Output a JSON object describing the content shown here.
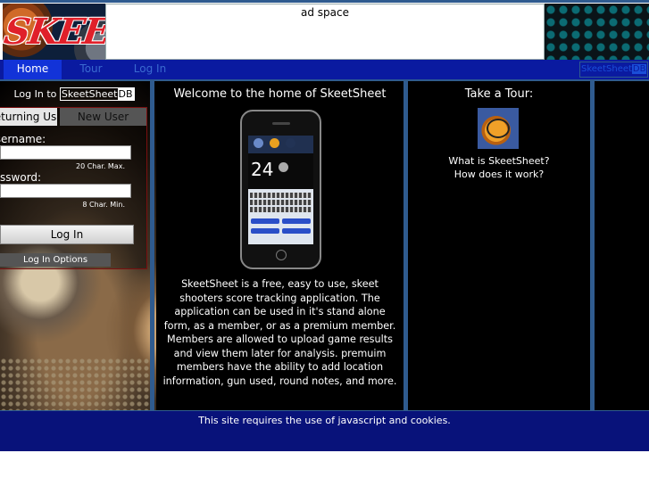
{
  "header": {
    "logo_text": "SKEETS",
    "ad_text": "ad space"
  },
  "nav": {
    "home": "Home",
    "tour": "Tour",
    "login": "Log In",
    "sheetdb_a": "SkeetSheet",
    "sheetdb_b": "DB"
  },
  "login": {
    "title_prefix": "Log In to",
    "badge_a": "SkeetSheet",
    "badge_b": "DB",
    "tab_returning": "Returning User",
    "tab_new": "New User",
    "username_label": "Username:",
    "username_hint": "20 Char. Max.",
    "password_label": "Password:",
    "password_hint": "8 Char. Min.",
    "login_button": "Log In",
    "options_button": "Log In Options"
  },
  "phone": {
    "big_number": "24"
  },
  "center": {
    "title": "Welcome to the home of SkeetSheet",
    "description": "SkeetSheet is a free, easy to use, skeet shooters score tracking application. The application can be used in it's stand alone form, as a member, or as a premium member. Members are allowed to upload game results and view them later for analysis. premuim members have the ability to add location information, gun used, round notes, and more."
  },
  "tour": {
    "title": "Take a Tour:",
    "link1": "What is SkeetSheet?",
    "link2": "How does it work?"
  },
  "footer": {
    "notice": "This site requires the use of javascript and cookies."
  },
  "colors": {
    "nav_bg": "#0a1aa0",
    "nav_active": "#1233d8",
    "border_blue": "#2f5b8f",
    "footer_bg": "#08127a"
  }
}
